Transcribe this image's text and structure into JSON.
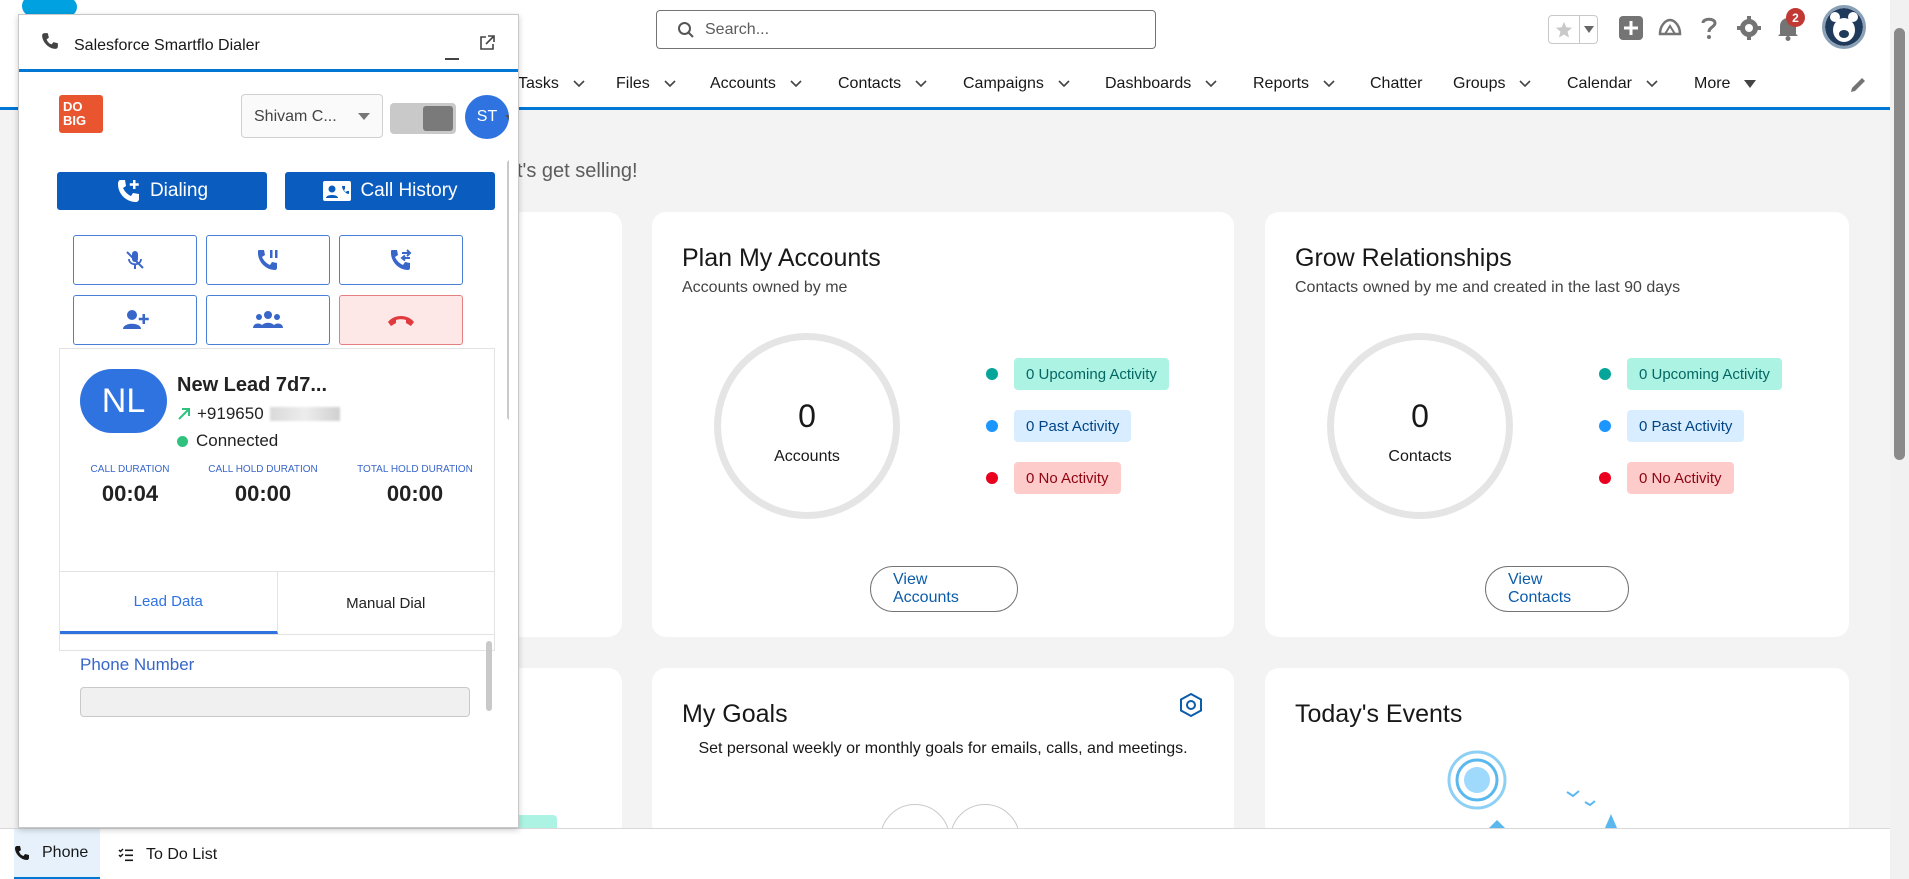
{
  "header": {
    "search_placeholder": "Search...",
    "notification_count": "2"
  },
  "nav": {
    "items": [
      {
        "label": "Tasks"
      },
      {
        "label": "Files"
      },
      {
        "label": "Accounts"
      },
      {
        "label": "Contacts"
      },
      {
        "label": "Campaigns"
      },
      {
        "label": "Dashboards"
      },
      {
        "label": "Reports"
      },
      {
        "label": "Chatter"
      },
      {
        "label": "Groups"
      },
      {
        "label": "Calendar"
      },
      {
        "label": "More"
      }
    ]
  },
  "main": {
    "greeting": "t's get selling!",
    "plan_accounts": {
      "title": "Plan My Accounts",
      "subtitle": "Accounts owned by me",
      "count": "0",
      "count_label": "Accounts",
      "upcoming": "0 Upcoming Activity",
      "past": "0 Past Activity",
      "none": "0 No Activity",
      "button": "View Accounts"
    },
    "grow_relationships": {
      "title": "Grow Relationships",
      "subtitle": "Contacts owned by me and created in the last 90 days",
      "count": "0",
      "count_label": "Contacts",
      "upcoming": "0 Upcoming Activity",
      "past": "0 Past Activity",
      "none": "0 No Activity",
      "button": "View Contacts"
    },
    "my_goals": {
      "title": "My Goals",
      "subtitle": "Set personal weekly or monthly goals for emails, calls, and meetings."
    },
    "todays_events": {
      "title": "Today's Events"
    },
    "colors": {
      "accent": "#0176d3",
      "upcoming_dot": "#06a59a",
      "past_dot": "#1b96ff",
      "none_dot": "#ea001e"
    }
  },
  "dialer": {
    "title": "Salesforce Smartflo Dialer",
    "logo_text": "DO BIG",
    "agent_name": "Shivam C...",
    "agent_initials": "ST",
    "dialing_label": "Dialing",
    "call_history_label": "Call History",
    "lead": {
      "initials": "NL",
      "name": "New Lead 7d7...",
      "phone": "+919650",
      "status": "Connected"
    },
    "durations": [
      {
        "label": "CALL DURATION",
        "value": "00:04"
      },
      {
        "label": "CALL HOLD DURATION",
        "value": "00:00"
      },
      {
        "label": "TOTAL HOLD DURATION",
        "value": "00:00"
      }
    ],
    "tabs": [
      {
        "label": "Lead Data"
      },
      {
        "label": "Manual Dial"
      }
    ],
    "phone_number_label": "Phone Number"
  },
  "utility_bar": {
    "phone_label": "Phone",
    "todo_label": "To Do List"
  }
}
